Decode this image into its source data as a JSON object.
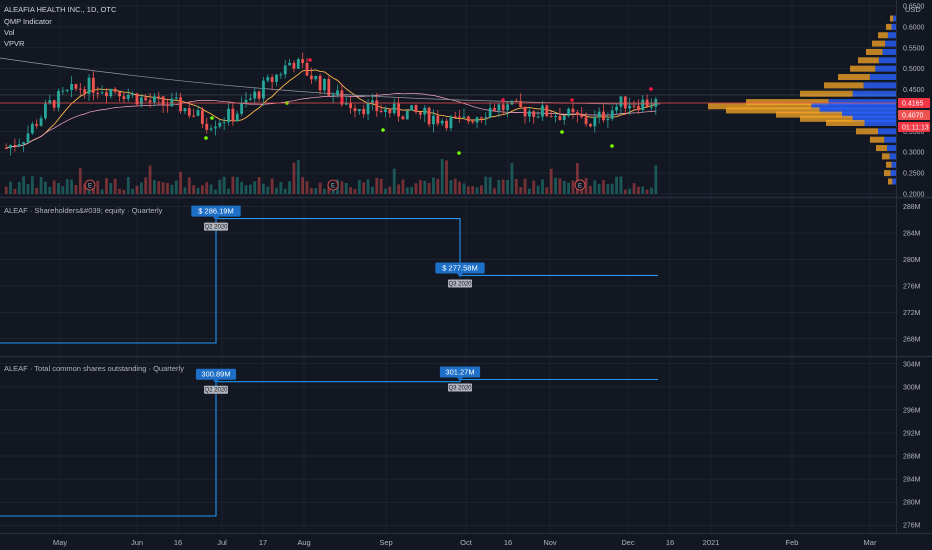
{
  "header": {
    "symbol": "ALEAFIA HEALTH INC., 1D, OTC",
    "indicators": [
      "QMP Indicator",
      "Vol",
      "VPVR"
    ],
    "currency": "USD"
  },
  "colors": {
    "background": "#131722",
    "grid": "#232836",
    "bull": "#26a69a",
    "bear": "#ef5350",
    "fundamental_line": "#2196f3",
    "tag_bg": "#1e6fc7",
    "qtag_bg": "#b2b5be",
    "price_tag": "#f23645"
  },
  "price_pane": {
    "y_ticks": [
      "0.6000",
      "0.5500",
      "0.5000",
      "0.4500",
      "0.3500",
      "0.3000",
      "0.2500",
      "0.2000"
    ],
    "y_top_tick": "0.6500",
    "price_labels": [
      {
        "text": "0.4165",
        "color": "#f23645"
      },
      {
        "text": "0.4070",
        "color": "#ef5350"
      },
      {
        "text": "01:11:13",
        "color": "#f23645"
      }
    ],
    "earnings_marker": "E"
  },
  "panes": [
    {
      "title": "ALEAF · Shareholders&#039; equity · Quarterly",
      "y_ticks": [
        "288M",
        "284M",
        "280M",
        "276M",
        "272M",
        "268M"
      ],
      "tags": [
        {
          "value": "$ 286.19M",
          "quarter": "Q2 2020"
        },
        {
          "value": "$ 277.58M",
          "quarter": "Q3 2020"
        }
      ]
    },
    {
      "title": "ALEAF · Total common shares outstanding · Quarterly",
      "y_ticks": [
        "304M",
        "300M",
        "296M",
        "292M",
        "288M",
        "284M",
        "280M",
        "276M"
      ],
      "tags": [
        {
          "value": "300.89M",
          "quarter": "Q2 2020"
        },
        {
          "value": "301.27M",
          "quarter": "Q3 2020"
        }
      ]
    }
  ],
  "x_axis": {
    "labels": [
      "May",
      "Jun",
      "16",
      "Jul",
      "17",
      "Aug",
      "Sep",
      "Oct",
      "16",
      "Nov",
      "Dec",
      "16",
      "2021",
      "Feb",
      "Mar"
    ]
  },
  "chart_data": [
    {
      "type": "line",
      "title": "ALEAF · Shareholders&#039; equity · Quarterly",
      "unit": "USD",
      "categories": [
        "Q2 2020",
        "Q3 2020"
      ],
      "values": [
        286190000,
        277580000
      ],
      "ylim": [
        266000000,
        289000000
      ]
    },
    {
      "type": "line",
      "title": "ALEAF · Total common shares outstanding · Quarterly",
      "categories": [
        "Q2 2020",
        "Q3 2020"
      ],
      "values": [
        300890000,
        301270000
      ],
      "ylim": [
        275000000,
        305000000
      ]
    },
    {
      "type": "candlestick",
      "title": "ALEAFIA HEALTH INC., 1D, OTC",
      "ylim": [
        0.2,
        0.65
      ],
      "last_price": 0.4165
    }
  ]
}
